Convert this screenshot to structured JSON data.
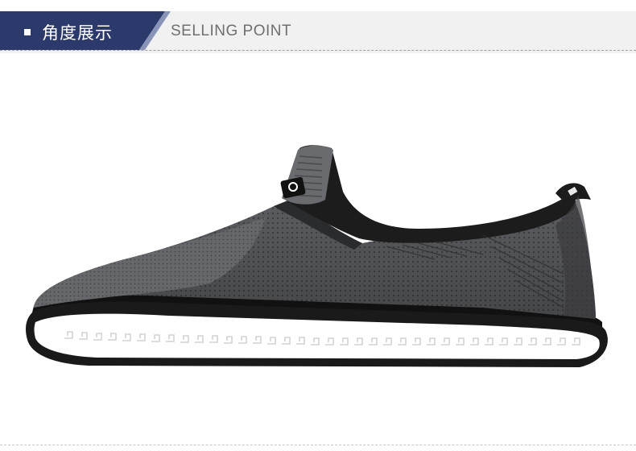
{
  "header": {
    "title": "角度展示",
    "subtitle": "SELLING POINT",
    "banner_color": "#2c3a6b",
    "accent_stripe_color": "#8a94b8"
  },
  "product": {
    "image_name": "slip-on-knit-shoe-side-view",
    "upper_color": "#5a5b5e",
    "collar_color": "#1c1c1c",
    "sole_color": "#ffffff",
    "sole_outline_color": "#1a1a1a"
  }
}
